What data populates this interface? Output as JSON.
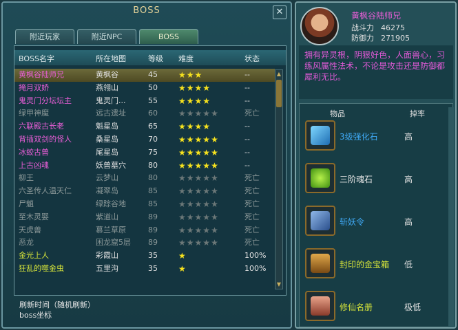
{
  "left": {
    "title": "BOSS",
    "close": "✕",
    "tabs": [
      "附近玩家",
      "附近NPC",
      "BOSS"
    ],
    "headers": [
      "BOSS名字",
      "所在地图",
      "等级",
      "难度",
      "状态"
    ],
    "rows": [
      {
        "name": "黄枫谷陆师兄",
        "map": "黄枫谷",
        "level": "45",
        "stars": 3,
        "status": "--",
        "style": "selected"
      },
      {
        "name": "掩月双娇",
        "map": "燕翎山",
        "level": "50",
        "stars": 4,
        "status": "--",
        "style": "pink"
      },
      {
        "name": "鬼灵门分坛坛主",
        "map": "鬼灵门...",
        "level": "55",
        "stars": 4,
        "status": "--",
        "style": "pink"
      },
      {
        "name": "绿甲神魔",
        "map": "远古遗址",
        "level": "60",
        "stars": 4,
        "status": "死亡",
        "style": "dead"
      },
      {
        "name": "六联殿古长老",
        "map": "魁星岛",
        "level": "65",
        "stars": 4,
        "status": "--",
        "style": "pink"
      },
      {
        "name": "背插双剑的怪人",
        "map": "桑星岛",
        "level": "70",
        "stars": 5,
        "status": "--",
        "style": "pink"
      },
      {
        "name": "冰蛟古兽",
        "map": "尾星岛",
        "level": "75",
        "stars": 5,
        "status": "--",
        "style": "pink"
      },
      {
        "name": "上古凶魂",
        "map": "妖兽墓穴",
        "level": "80",
        "stars": 5,
        "status": "--",
        "style": "pink"
      },
      {
        "name": "柳王",
        "map": "云梦山",
        "level": "80",
        "stars": 5,
        "status": "死亡",
        "style": "dead"
      },
      {
        "name": "六圣传人温天仁",
        "map": "凝翠岛",
        "level": "85",
        "stars": 5,
        "status": "死亡",
        "style": "dead"
      },
      {
        "name": "尸魈",
        "map": "绿踪谷地",
        "level": "85",
        "stars": 5,
        "status": "死亡",
        "style": "dead"
      },
      {
        "name": "至木灵婴",
        "map": "紫道山",
        "level": "89",
        "stars": 5,
        "status": "死亡",
        "style": "dead"
      },
      {
        "name": "天虎兽",
        "map": "慕兰草原",
        "level": "89",
        "stars": 5,
        "status": "死亡",
        "style": "dead"
      },
      {
        "name": "恶龙",
        "map": "困龙窟5层",
        "level": "89",
        "stars": 5,
        "status": "死亡",
        "style": "dead"
      },
      {
        "name": "金光上人",
        "map": "彩霞山",
        "level": "35",
        "stars": 1,
        "status": "100%",
        "style": "yellow"
      },
      {
        "name": "狂乱的噬金虫",
        "map": "五里沟",
        "level": "35",
        "stars": 1,
        "status": "100%",
        "style": "yellow"
      }
    ],
    "footer": [
      "刷新时间（随机刷新）",
      "boss坐标"
    ]
  },
  "right": {
    "npc_name": "黄枫谷陆师兄",
    "combat_label": "战斗力",
    "combat_value": "46275",
    "defense_label": "防御力",
    "defense_value": "271905",
    "description": "拥有异灵根，阴狠好色，人面兽心，习练风属性法术，不论是攻击还是防御都犀利无比。",
    "drop_header_item": "物品",
    "drop_header_rate": "掉率",
    "drops": [
      {
        "name": "3级强化石",
        "rate": "高",
        "color": "#3fa9f5",
        "icon": "crystal-icon"
      },
      {
        "name": "三阶魂石",
        "rate": "高",
        "color": "#e6e6e6",
        "icon": "green-soul-stone-icon"
      },
      {
        "name": "斩妖令",
        "rate": "高",
        "color": "#3fa9f5",
        "icon": "token-icon"
      },
      {
        "name": "封印的金宝箱",
        "rate": "低",
        "color": "#d6e43a",
        "icon": "treasure-chest-icon"
      },
      {
        "name": "修仙名册",
        "rate": "极低",
        "color": "#d6e43a",
        "icon": "book-icon"
      }
    ]
  }
}
